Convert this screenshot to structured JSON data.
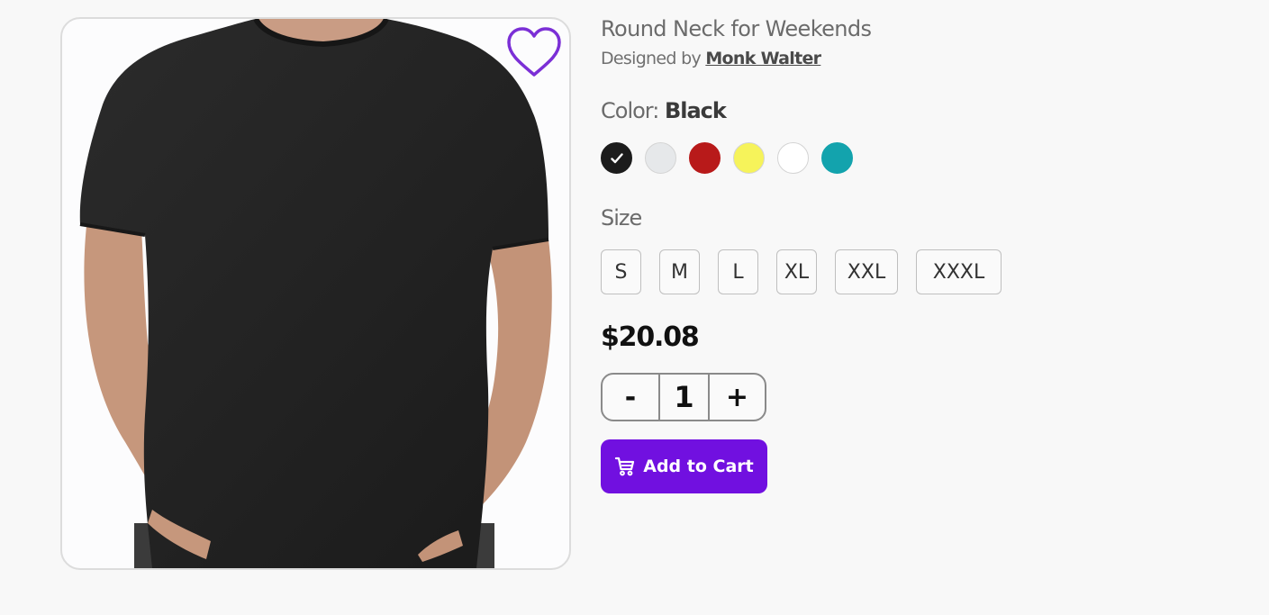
{
  "product": {
    "title": "Round Neck for Weekends",
    "designed_by_label": "Designed by",
    "designer_name": "Monk Walter",
    "image_icon": "tshirt-photo",
    "wishlist_icon": "heart-icon",
    "wishlist_color": "#7b2fd6"
  },
  "color": {
    "label": "Color:",
    "selected": "Black",
    "swatches": [
      {
        "name": "Black",
        "hex": "#1c1c1c",
        "selected": true
      },
      {
        "name": "Light Gray",
        "hex": "#e6e8ea",
        "selected": false
      },
      {
        "name": "Red",
        "hex": "#b81a1a",
        "selected": false
      },
      {
        "name": "Yellow",
        "hex": "#f6f35a",
        "selected": false
      },
      {
        "name": "White",
        "hex": "#ffffff",
        "selected": false
      },
      {
        "name": "Teal",
        "hex": "#13a3ad",
        "selected": false
      }
    ]
  },
  "size": {
    "label": "Size",
    "options": [
      "S",
      "M",
      "L",
      "XL",
      "XXL",
      "XXXL"
    ]
  },
  "price": "$20.08",
  "quantity": {
    "minus_label": "-",
    "value": "1",
    "plus_label": "+"
  },
  "cart": {
    "label": "Add to Cart",
    "icon": "cart-icon",
    "bg_color": "#7110e0"
  }
}
